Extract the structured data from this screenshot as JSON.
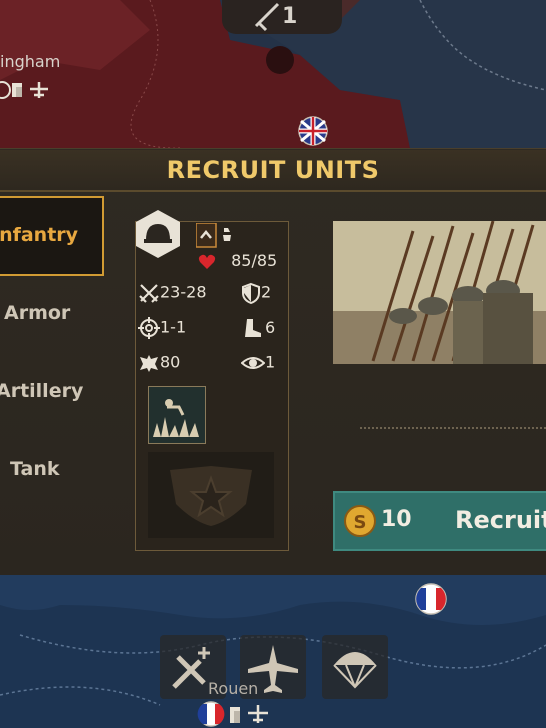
{
  "map": {
    "city_top_label": "ingham",
    "fleet_count": "1",
    "city_bottom_label": "Rouen"
  },
  "panel": {
    "title": "RECRUIT UNITS",
    "tabs": [
      {
        "label": "Infantry",
        "active": true
      },
      {
        "label": "Armor",
        "active": false
      },
      {
        "label": "Artillery",
        "active": false
      },
      {
        "label": "Tank",
        "active": false
      }
    ]
  },
  "unit": {
    "hp": "85/85",
    "attack": "23-28",
    "defense": "2",
    "range": "1-1",
    "movement": "6",
    "organization": "80",
    "vision": "1"
  },
  "recruit": {
    "cost": "10",
    "label": "Recruit"
  },
  "colors": {
    "accent_gold": "#e8a840",
    "recruit_button": "#2f6f68",
    "enemy_territory": "#5c1a1e"
  }
}
